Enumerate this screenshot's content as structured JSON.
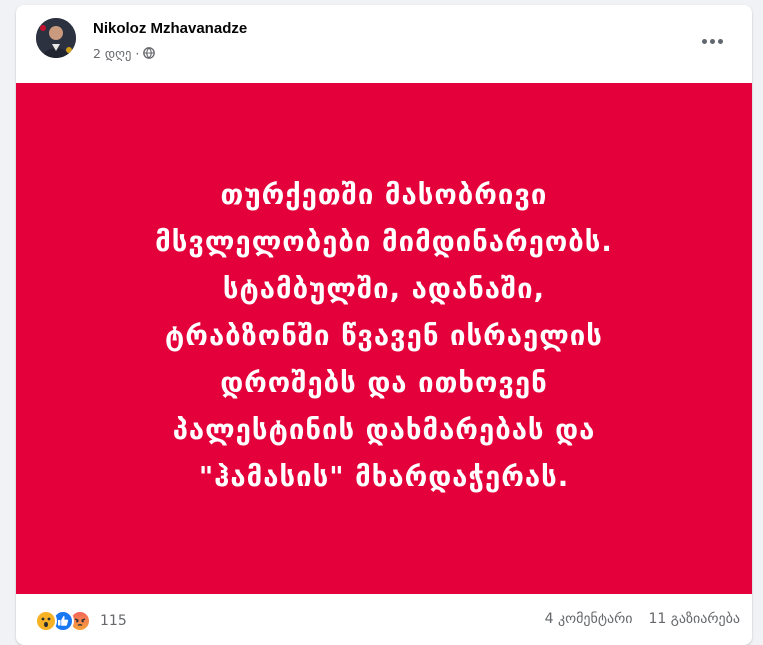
{
  "post": {
    "author": "Nikoloz Mzhavanadze",
    "time": "2 დღე",
    "separator": "·",
    "privacy_icon": "globe-icon",
    "more_icon": "ellipsis-icon",
    "text_lines": [
      "თურქეთში მასობრივი",
      "მსვლელობები მიმდინარეობს.",
      "სტამბულში, ადანაში,",
      "ტრაბზონში წვავენ ისრაელის",
      "დროშებს და ითხოვენ",
      "პალესტინის დახმარებას და",
      "\"ჰამასის\" მხარდაჭერას."
    ],
    "background_color": "#e4003a",
    "text_color": "#ffffff"
  },
  "footer": {
    "reaction_icons": [
      "wow-icon",
      "like-icon",
      "angry-icon"
    ],
    "reaction_count": "115",
    "comments": "4 კომენტარი",
    "shares": "11 გაზიარება"
  }
}
